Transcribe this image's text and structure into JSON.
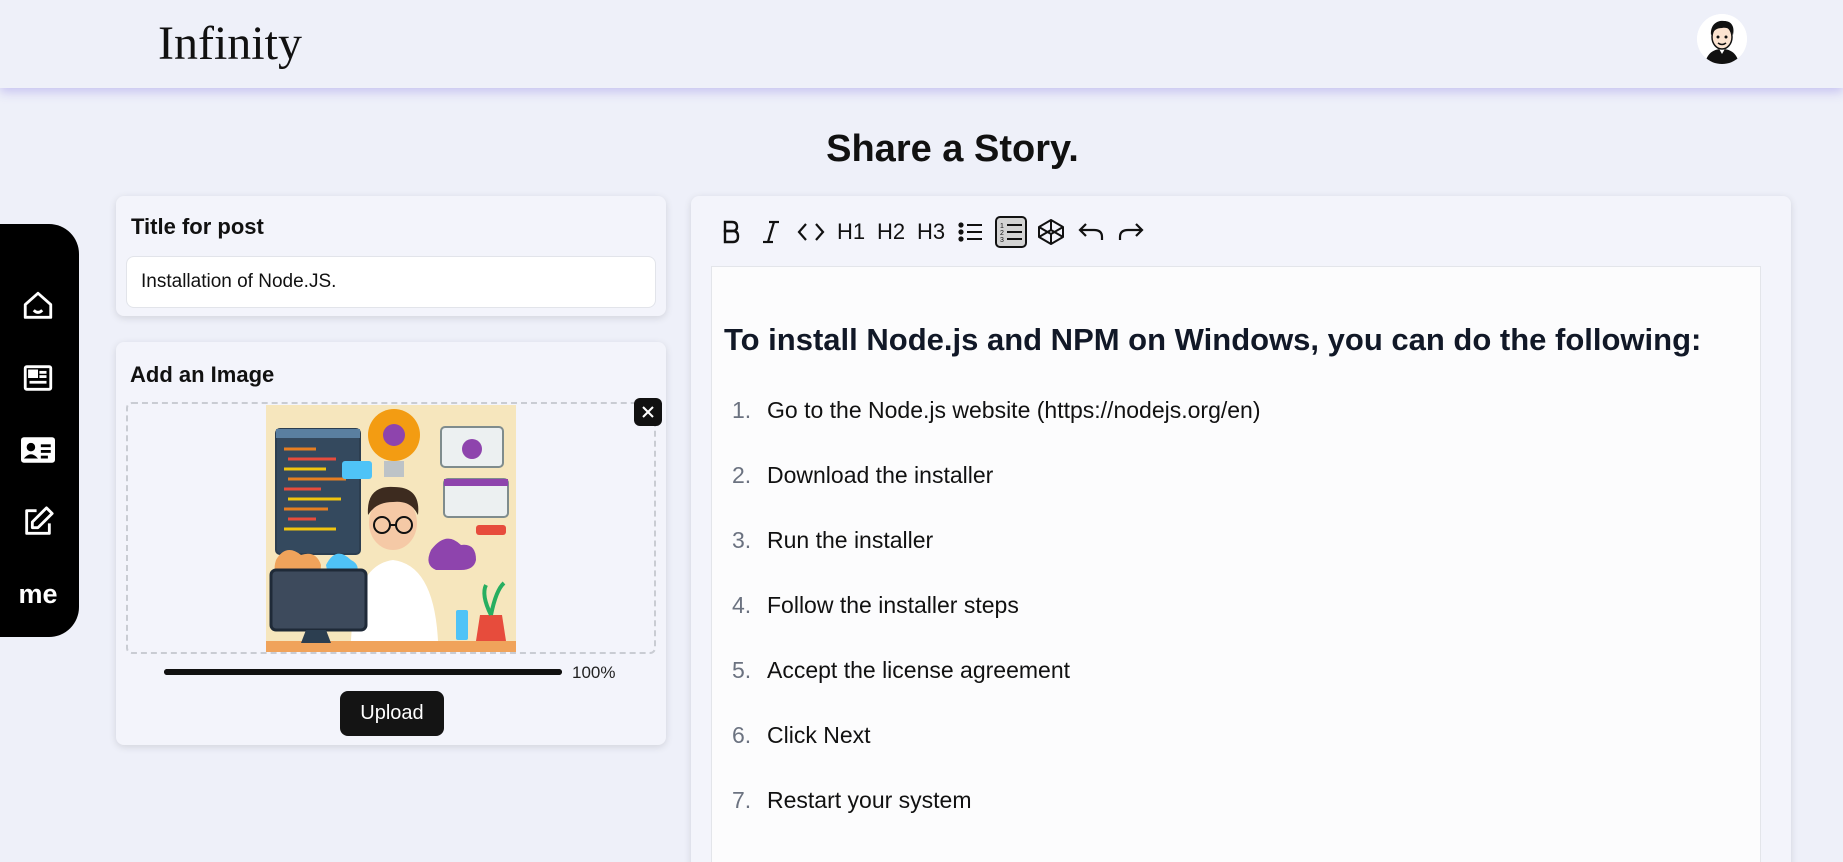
{
  "app": {
    "brand": "Infinity"
  },
  "page": {
    "title": "Share a Story."
  },
  "sidebar": {
    "items": [
      {
        "name": "home",
        "icon": "home-icon"
      },
      {
        "name": "feed",
        "icon": "newspaper-icon"
      },
      {
        "name": "profile",
        "icon": "id-card-icon"
      },
      {
        "name": "write",
        "icon": "edit-icon"
      },
      {
        "name": "me",
        "label": "me"
      }
    ]
  },
  "post_title": {
    "heading": "Title for post",
    "value": "Installation of Node.JS."
  },
  "image_upload": {
    "heading": "Add an Image",
    "progress_percent": 100,
    "progress_text": "100%",
    "upload_label": "Upload"
  },
  "editor": {
    "toolbar": [
      "bold-icon",
      "italic-icon",
      "code-icon",
      "heading-1-icon",
      "heading-2-icon",
      "heading-3-icon",
      "bullet-list-icon",
      "ordered-list-icon",
      "codeblock-icon",
      "undo-icon",
      "redo-icon"
    ],
    "toolbar_labels": {
      "h1": "H1",
      "h2": "H2",
      "h3": "H3"
    },
    "active_tool": "ordered-list-icon",
    "heading": "To install Node.js and NPM on Windows, you can do the following:",
    "steps": [
      {
        "num": "1.",
        "text": "Go to the Node.js website (https://nodejs.org/en)"
      },
      {
        "num": "2.",
        "text": "Download the installer"
      },
      {
        "num": "3.",
        "text": "Run the installer"
      },
      {
        "num": "4.",
        "text": "Follow the installer steps"
      },
      {
        "num": "5.",
        "text": "Accept the license agreement"
      },
      {
        "num": "6.",
        "text": "Click Next"
      },
      {
        "num": "7.",
        "text": "Restart your system"
      }
    ]
  },
  "colors": {
    "background": "#eef0f9",
    "accent_shadow": "#968ce6",
    "sidebar": "#000000"
  }
}
